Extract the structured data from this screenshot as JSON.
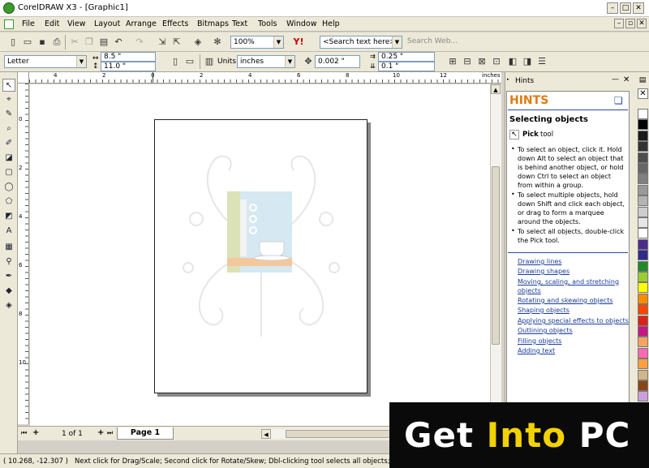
{
  "window": {
    "title": "CorelDRAW X3 - [Graphic1]"
  },
  "menubar": {
    "items": [
      "File",
      "Edit",
      "View",
      "Layout",
      "Arrange",
      "Effects",
      "Bitmaps",
      "Text",
      "Tools",
      "Window",
      "Help"
    ]
  },
  "toolbar": {
    "zoom": "100%",
    "search_placeholder": "<Search text here>",
    "search_web": "Search Web..."
  },
  "propbar": {
    "paper": "Letter",
    "width": "8.5 \"",
    "height": "11.0 \"",
    "units_label": "Units:",
    "units": "inches",
    "nudge": "0.002 \"",
    "dup_x": "0.25 \"",
    "dup_y": "0.1 \""
  },
  "ruler": {
    "units": "inches",
    "h_ticks": [
      "4",
      "2",
      "0",
      "2",
      "4",
      "6",
      "8",
      "10",
      "12"
    ],
    "v_ticks": [
      "0",
      "2",
      "4",
      "6",
      "8",
      "10"
    ]
  },
  "pages": {
    "counter": "1 of 1",
    "tab": "Page 1"
  },
  "status": {
    "coords": "( 10.268, -12.307 )",
    "message": "Next click for Drag/Scale; Second click for Rotate/Skew; Dbl-clicking tool selects all objects; Shift+click m"
  },
  "docker": {
    "title": "Hints",
    "header": "HINTS",
    "section": "Selecting objects",
    "tool_name": "Pick",
    "tool_suffix": "tool",
    "bullets": [
      "To select an object, click it. Hold down Alt to select an object that is behind another object, or hold down Ctrl to select an object from within a group.",
      "To select multiple objects, hold down Shift and click each object, or drag to form a marquee around the objects.",
      "To select all objects, double-click the Pick tool."
    ],
    "links": [
      "Drawing lines",
      "Drawing shapes",
      "Moving, scaling, and stretching objects",
      "Rotating and skewing objects",
      "Shaping objects",
      "Applying special effects to objects",
      "Outlining objects",
      "Filling objects",
      "Adding text"
    ]
  },
  "palette": {
    "colors": [
      "#ffffff",
      "#000000",
      "#1a1a1a",
      "#333333",
      "#4d4d4d",
      "#666666",
      "#808080",
      "#999999",
      "#b3b3b3",
      "#cccccc",
      "#e6e6e6",
      "#ffffff",
      "#4b2c8a",
      "#2e2a8c",
      "#1f8a2a",
      "#9acd32",
      "#ffff00",
      "#ff8c00",
      "#ff4500",
      "#e0201a",
      "#c71585",
      "#f4a460",
      "#ff69b4",
      "#ff9f40",
      "#d2b48c",
      "#8b4513",
      "#c9a0dc",
      "#9370db",
      "#7b68ee"
    ]
  },
  "watermark": {
    "text1": "Get ",
    "text2": "Into",
    "text3": " PC"
  }
}
